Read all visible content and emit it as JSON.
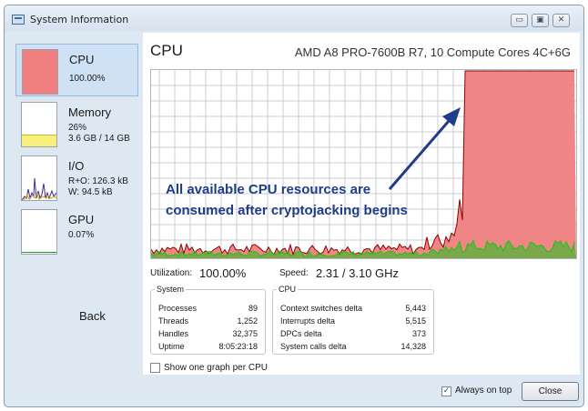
{
  "window": {
    "title": "System Information"
  },
  "titlebar_buttons": {
    "minimize": "▭",
    "maximize": "▣",
    "close": "✕"
  },
  "sidebar": {
    "cpu": {
      "label": "CPU",
      "value": "100.00%",
      "usage": 1.0
    },
    "memory": {
      "label": "Memory",
      "percent": "26%",
      "detail": "3.6 GB / 14 GB",
      "usage": 0.26
    },
    "io": {
      "label": "I/O",
      "read": "R+O: 126.3 kB",
      "write": "W: 94.5 kB"
    },
    "gpu": {
      "label": "GPU",
      "value": "0.07%"
    },
    "back_label": "Back"
  },
  "main": {
    "title": "CPU",
    "model": "AMD A8 PRO-7600B R7, 10 Compute Cores 4C+6G",
    "annotation_line1": "All available CPU resources are",
    "annotation_line2": "consumed after cryptojacking begins",
    "utilization_label": "Utilization:",
    "utilization_value": "100.00%",
    "speed_label": "Speed:",
    "speed_value": "2.31 / 3.10 GHz"
  },
  "system_group": {
    "title": "System",
    "rows": [
      {
        "key": "Processes",
        "value": "89"
      },
      {
        "key": "Threads",
        "value": "1,252"
      },
      {
        "key": "Handles",
        "value": "32,375"
      },
      {
        "key": "Uptime",
        "value": "8:05:23:18"
      }
    ]
  },
  "cpu_group": {
    "title": "CPU",
    "rows": [
      {
        "key": "Context switches delta",
        "value": "5,443"
      },
      {
        "key": "Interrupts delta",
        "value": "5,515"
      },
      {
        "key": "DPCs delta",
        "value": "373"
      },
      {
        "key": "System calls delta",
        "value": "14,328"
      }
    ]
  },
  "options": {
    "one_graph_label": "Show one graph per CPU",
    "always_on_top_label": "Always on top",
    "always_on_top_checked": true
  },
  "footer": {
    "close_label": "Close"
  },
  "colors": {
    "cpu_fill": "#f08080",
    "line_red": "#8b0000",
    "line_green": "#19c419",
    "grid": "#c8ccd2",
    "annotation": "#1f3c88",
    "memory_fill": "#f7ef7a"
  }
}
